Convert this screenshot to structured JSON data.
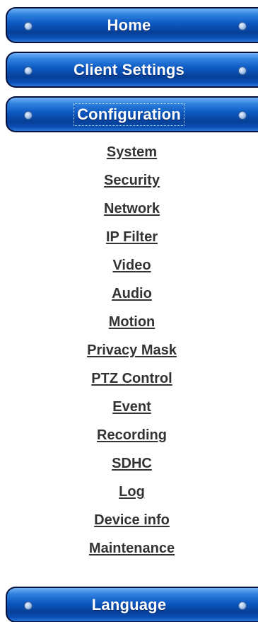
{
  "nav": {
    "home": "Home",
    "client_settings": "Client Settings",
    "configuration": "Configuration",
    "language": "Language"
  },
  "submenu": [
    "System",
    "Security",
    "Network",
    "IP Filter",
    "Video",
    "Audio",
    "Motion",
    "Privacy Mask",
    "PTZ Control",
    "Event",
    "Recording",
    "SDHC",
    "Log",
    "Device info",
    "Maintenance"
  ],
  "colors": {
    "button_blue": "#0c58c2",
    "button_border": "#000f3a",
    "link": "#333333"
  },
  "icons": {
    "rivet": "rivet-icon"
  }
}
